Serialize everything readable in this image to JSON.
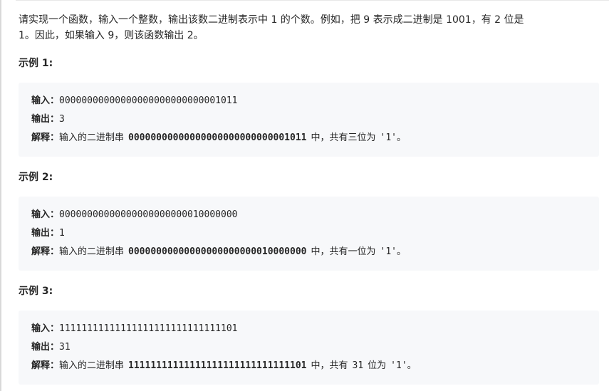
{
  "intro": {
    "line1": "请实现一个函数，输入一个整数，输出该数二进制表示中 1 的个数。例如，把 9 表示成二进制是 1001，有 2 位是",
    "line2": "1。因此，如果输入 9，则该函数输出 2。"
  },
  "labels": {
    "input": "输入：",
    "output": "输出：",
    "explain": "解释："
  },
  "examples": [
    {
      "title": "示例 1:",
      "input": "00000000000000000000000000001011",
      "output": "3",
      "explain_prefix": "输入的二进制串",
      "explain_code": "00000000000000000000000000001011",
      "explain_middle": "中，共有三位为",
      "explain_count": "",
      "explain_mid2": "",
      "explain_quote": "'1'",
      "explain_suffix": "。"
    },
    {
      "title": "示例 2:",
      "input": "00000000000000000000000010000000",
      "output": "1",
      "explain_prefix": "输入的二进制串",
      "explain_code": "00000000000000000000000010000000",
      "explain_middle": "中，共有一位为",
      "explain_count": "",
      "explain_mid2": "",
      "explain_quote": "'1'",
      "explain_suffix": "。"
    },
    {
      "title": "示例 3:",
      "input": "11111111111111111111111111111101",
      "output": "31",
      "explain_prefix": "输入的二进制串",
      "explain_code": "11111111111111111111111111111101",
      "explain_middle": "中，共有",
      "explain_count": "31",
      "explain_mid2": "位为",
      "explain_quote": "'1'",
      "explain_suffix": "。"
    }
  ]
}
